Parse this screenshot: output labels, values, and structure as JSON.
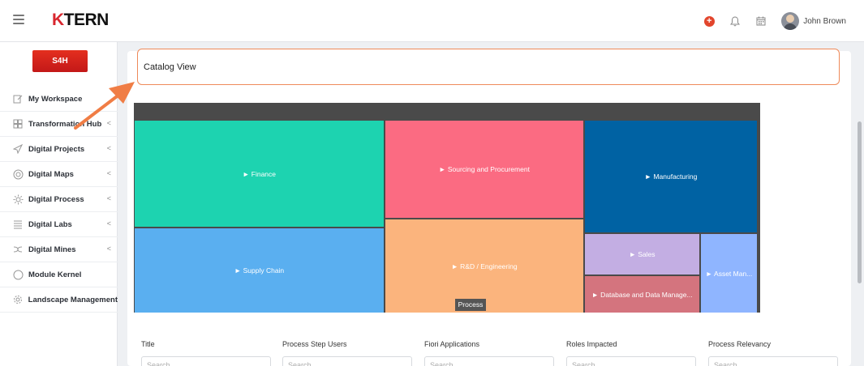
{
  "header": {
    "logo_k": "K",
    "logo_rest": "TERN",
    "user_name": "John Brown",
    "icons": [
      "menu-icon",
      "add-icon",
      "bell-icon",
      "calendar-icon",
      "avatar"
    ]
  },
  "sidebar": {
    "badge": "S4H",
    "items": [
      {
        "label": "My Workspace",
        "icon": "edit-icon",
        "chevron": false
      },
      {
        "label": "Transformation Hub",
        "icon": "grid-icon",
        "chevron": true
      },
      {
        "label": "Digital Projects",
        "icon": "send-icon",
        "chevron": true
      },
      {
        "label": "Digital Maps",
        "icon": "compass-icon",
        "chevron": true
      },
      {
        "label": "Digital Process",
        "icon": "sun-icon",
        "chevron": true
      },
      {
        "label": "Digital Labs",
        "icon": "list-icon",
        "chevron": true
      },
      {
        "label": "Digital Mines",
        "icon": "shuffle-icon",
        "chevron": true
      },
      {
        "label": "Module Kernel",
        "icon": "circle-icon",
        "chevron": false
      },
      {
        "label": "Landscape Management",
        "icon": "gear-icon",
        "chevron": false
      }
    ]
  },
  "main": {
    "title": "Catalog View",
    "tooltip": "Process"
  },
  "chart_data": {
    "type": "treemap",
    "tiles": [
      {
        "label": "► Finance",
        "color": "#1dd3b0"
      },
      {
        "label": "► Supply Chain",
        "color": "#5aaff0"
      },
      {
        "label": "► Sourcing and Procurement",
        "color": "#fb6b82"
      },
      {
        "label": "► R&D / Engineering",
        "color": "#fbb47d"
      },
      {
        "label": "► Manufacturing",
        "color": "#0062a3"
      },
      {
        "label": "► Sales",
        "color": "#c3aee3"
      },
      {
        "label": "► Database and Data Manage...",
        "color": "#d4747e"
      },
      {
        "label": "► Asset Man...",
        "color": "#8fb5ff"
      }
    ]
  },
  "filters": [
    {
      "label": "Title",
      "placeholder": "Search"
    },
    {
      "label": "Process Step Users",
      "placeholder": "Search"
    },
    {
      "label": "Fiori Applications",
      "placeholder": "Search"
    },
    {
      "label": "Roles Impacted",
      "placeholder": "Search"
    },
    {
      "label": "Process Relevancy",
      "placeholder": "Search"
    }
  ],
  "colors": {
    "accent": "#ee8a5a",
    "brand_red": "#d8262e"
  }
}
